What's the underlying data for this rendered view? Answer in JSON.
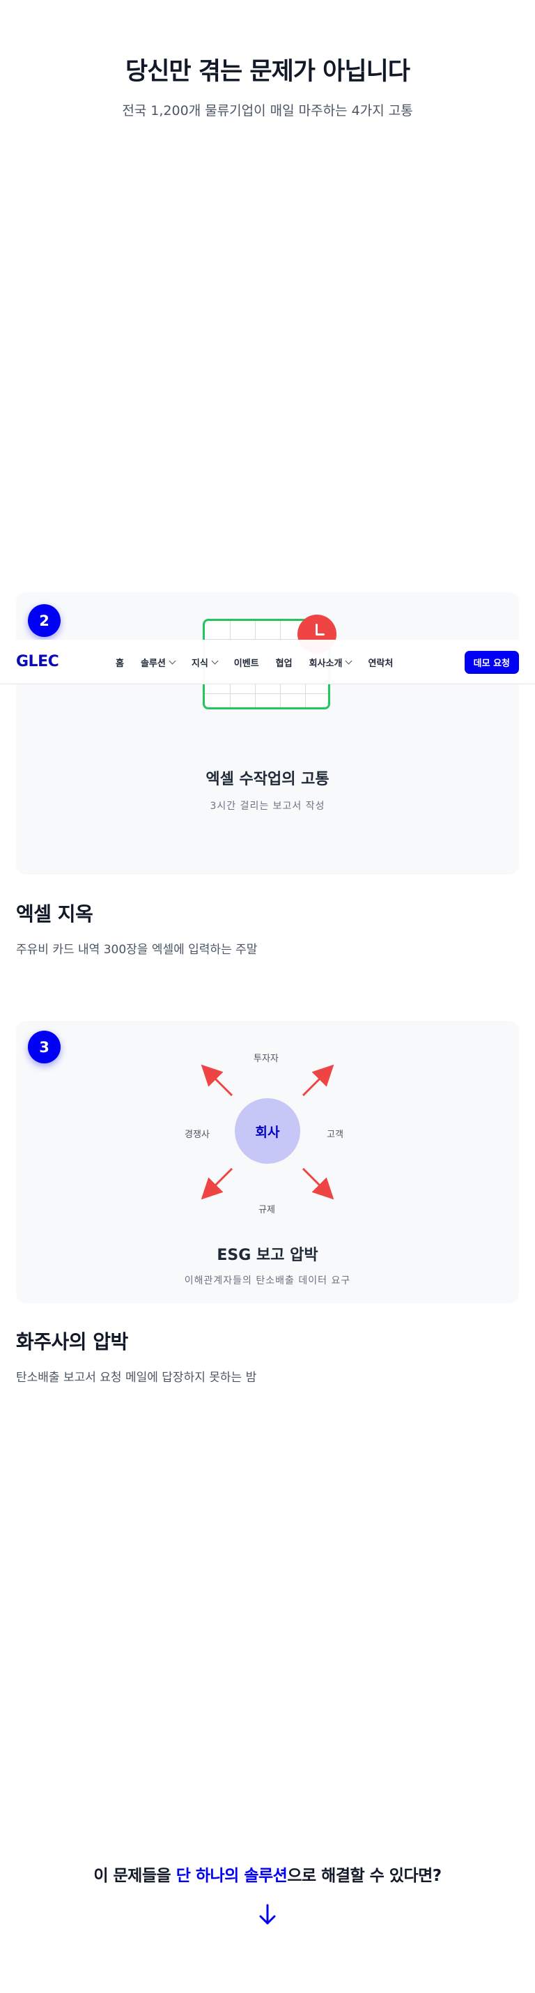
{
  "hero": {
    "title": "당신만 겪는 문제가 아닙니다",
    "subtitle": "전국 1,200개 물류기업이 매일 마주하는 4가지 고통"
  },
  "navbar": {
    "logo": "GLEC",
    "items": [
      {
        "label": "홈",
        "dropdown": false
      },
      {
        "label": "솔루션",
        "dropdown": true
      },
      {
        "label": "지식",
        "dropdown": true
      },
      {
        "label": "이벤트",
        "dropdown": false
      },
      {
        "label": "협업",
        "dropdown": false
      },
      {
        "label": "회사소개",
        "dropdown": true
      },
      {
        "label": "연락처",
        "dropdown": false
      }
    ],
    "demo_button": "데모 요청"
  },
  "card2": {
    "number": "2",
    "title": "엑셀 수작업의 고통",
    "subtitle": "3시간 걸리는 보고서 작성",
    "icons": [
      "spreadsheet-icon",
      "clock-icon"
    ]
  },
  "section2": {
    "title": "엑셀 지옥",
    "description": "주유비 카드 내역 300장을 엑셀에 입력하는 주말"
  },
  "card3": {
    "number": "3",
    "title": "ESG 보고 압박",
    "subtitle": "이해관계자들의 탄소배출 데이터 요구",
    "center": "회사",
    "nodes": {
      "top": "투자자",
      "left": "경쟁사",
      "right": "고객",
      "bottom": "규제"
    }
  },
  "section3": {
    "title": "화주사의 압박",
    "description": "탄소배출 보고서 요청 메일에 답장하지 못하는 밤"
  },
  "cta": {
    "before": "이 문제들을 ",
    "highlight": "단 하나의 솔루션",
    "after": "으로 해결할 수 있다면?"
  },
  "colors": {
    "accent": "#0000f5",
    "excel_green": "#22c55e",
    "alert_red": "#ef4444",
    "center_circle": "#c7c7f7"
  }
}
